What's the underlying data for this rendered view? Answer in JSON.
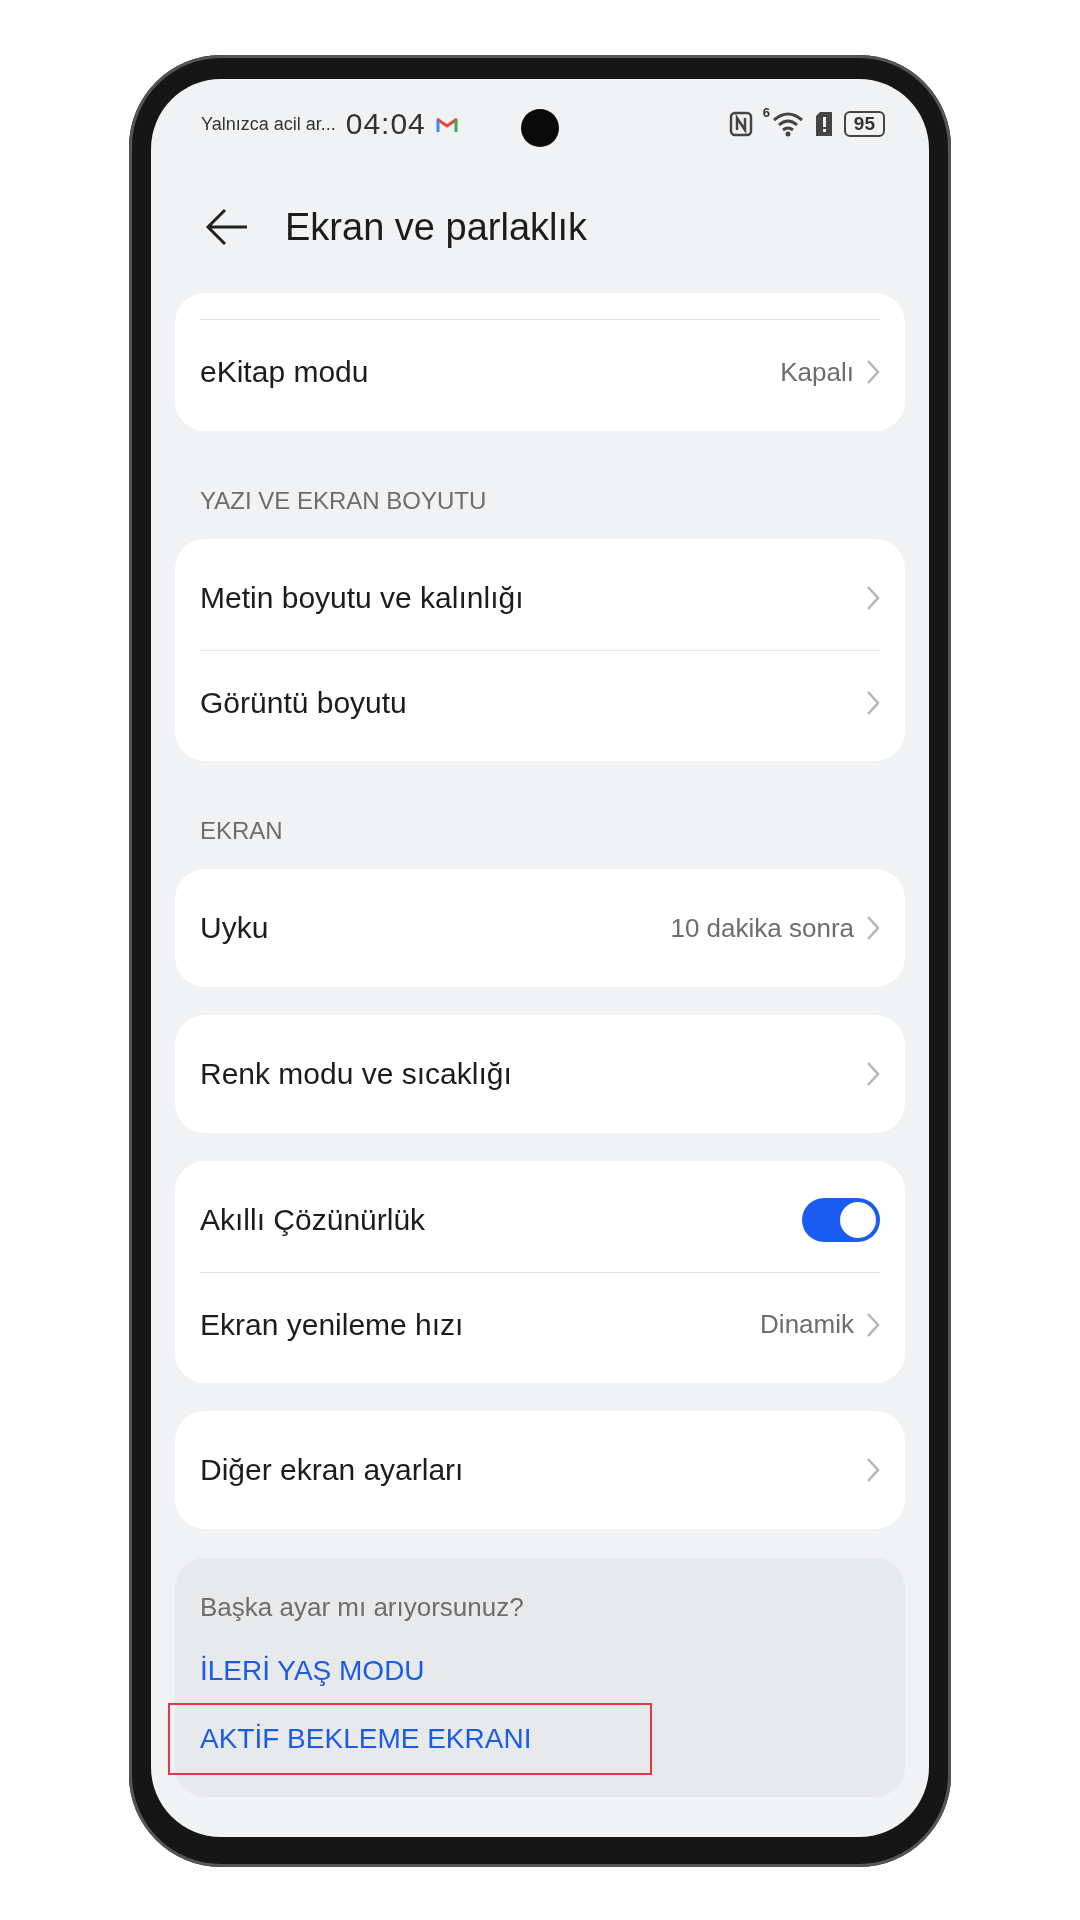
{
  "status_bar": {
    "notification_text": "Yalnızca acil ar...",
    "time": "04:04",
    "network_badge": "6",
    "battery": "95"
  },
  "header": {
    "title": "Ekran ve parlaklık"
  },
  "groups": [
    {
      "partial_top": true,
      "rows": [
        {
          "kind": "link",
          "label": "eKitap modu",
          "value": "Kapalı"
        }
      ]
    },
    {
      "section": "YAZI VE EKRAN BOYUTU",
      "rows": [
        {
          "kind": "link",
          "label": "Metin boyutu ve kalınlığı"
        },
        {
          "kind": "link",
          "label": "Görüntü boyutu"
        }
      ]
    },
    {
      "section": "EKRAN",
      "rows": [
        {
          "kind": "link",
          "label": "Uyku",
          "value": "10 dakika sonra"
        }
      ]
    },
    {
      "rows": [
        {
          "kind": "link",
          "label": "Renk modu ve sıcaklığı"
        }
      ]
    },
    {
      "rows": [
        {
          "kind": "toggle",
          "label": "Akıllı Çözünürlük",
          "on": true
        },
        {
          "kind": "link",
          "label": "Ekran yenileme hızı",
          "value": "Dinamik"
        }
      ]
    },
    {
      "rows": [
        {
          "kind": "link",
          "label": "Diğer ekran ayarları"
        }
      ]
    }
  ],
  "suggestions": {
    "prompt": "Başka ayar mı arıyorsunuz?",
    "links": [
      {
        "label": "İLERİ YAŞ MODU",
        "highlighted": false
      },
      {
        "label": "AKTİF BEKLEME EKRANI",
        "highlighted": true
      }
    ]
  }
}
